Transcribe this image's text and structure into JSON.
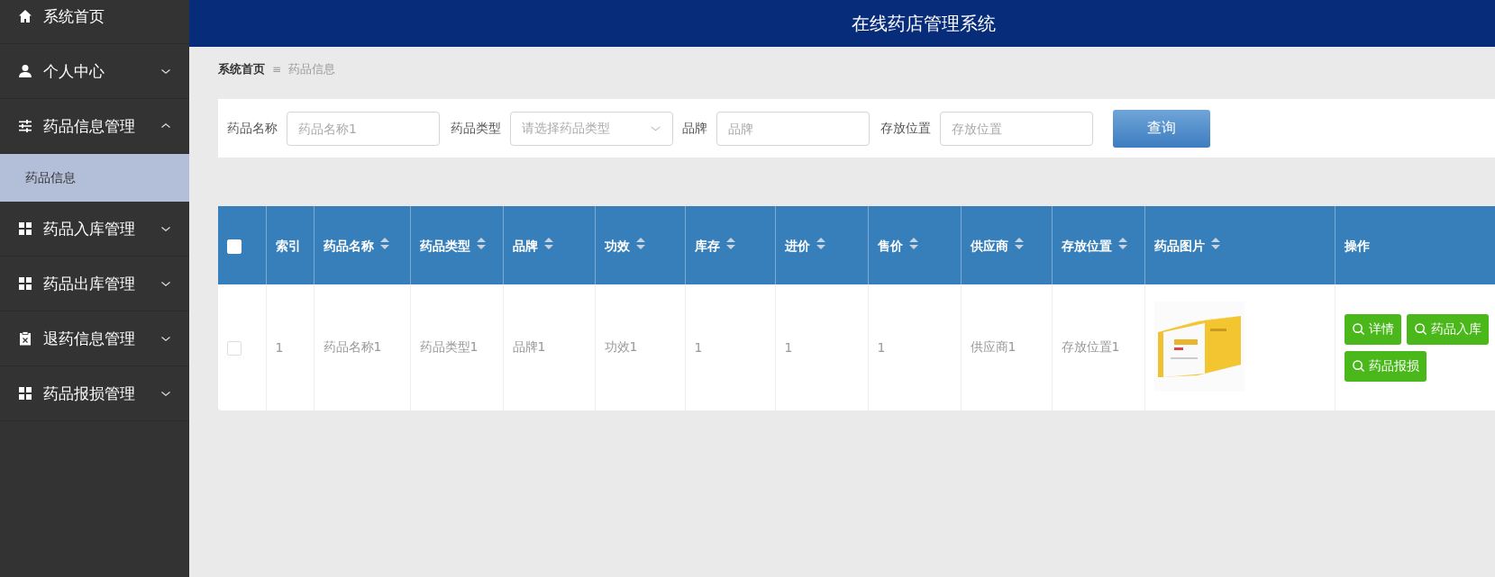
{
  "app_title": "在线药店管理系统",
  "sidebar": {
    "items": [
      {
        "label": "系统首页",
        "selected": false
      },
      {
        "label": "个人中心",
        "selected": false,
        "expanded": false
      },
      {
        "label": "药品信息管理",
        "selected": false,
        "expanded": true,
        "children": [
          {
            "label": "药品信息",
            "selected": true
          }
        ]
      },
      {
        "label": "药品入库管理",
        "selected": false,
        "expanded": false
      },
      {
        "label": "药品出库管理",
        "selected": false,
        "expanded": false
      },
      {
        "label": "退药信息管理",
        "selected": false,
        "expanded": false
      },
      {
        "label": "药品报损管理",
        "selected": false,
        "expanded": false
      }
    ]
  },
  "breadcrumb": {
    "items": [
      "系统首页",
      "药品信息"
    ],
    "separator": "≡"
  },
  "search": {
    "fields": [
      {
        "label": "药品名称",
        "placeholder": "药品名称1",
        "kind": "text"
      },
      {
        "label": "药品类型",
        "placeholder": "请选择药品类型",
        "kind": "select"
      },
      {
        "label": "品牌",
        "placeholder": "品牌",
        "kind": "text"
      },
      {
        "label": "存放位置",
        "placeholder": "存放位置",
        "kind": "text"
      }
    ],
    "button": "查询"
  },
  "table": {
    "select_all": {
      "checked": false
    },
    "columns": [
      {
        "label": "索引",
        "sortable": false,
        "kind": "text"
      },
      {
        "label": "药品名称",
        "sortable": true,
        "kind": "text"
      },
      {
        "label": "药品类型",
        "sortable": true,
        "kind": "text"
      },
      {
        "label": "品牌",
        "sortable": true,
        "kind": "text"
      },
      {
        "label": "功效",
        "sortable": true,
        "kind": "text"
      },
      {
        "label": "库存",
        "sortable": true,
        "kind": "text"
      },
      {
        "label": "进价",
        "sortable": true,
        "kind": "text"
      },
      {
        "label": "售价",
        "sortable": true,
        "kind": "text"
      },
      {
        "label": "供应商",
        "sortable": true,
        "kind": "text"
      },
      {
        "label": "存放位置",
        "sortable": true,
        "kind": "text"
      },
      {
        "label": "药品图片",
        "sortable": true
      },
      {
        "label": "操作",
        "sortable": false,
        "kind": "actions"
      }
    ],
    "rows": [
      {
        "checked": false,
        "cells": [
          "1",
          "药品名称1",
          "药品类型1",
          "品牌1",
          "功效1",
          "1",
          "1",
          "1",
          "供应商1",
          "存放位置1"
        ],
        "image": {
          "kind": "picture"
        },
        "actions": [
          "详情",
          "药品入库",
          "药品报损"
        ]
      }
    ]
  }
}
